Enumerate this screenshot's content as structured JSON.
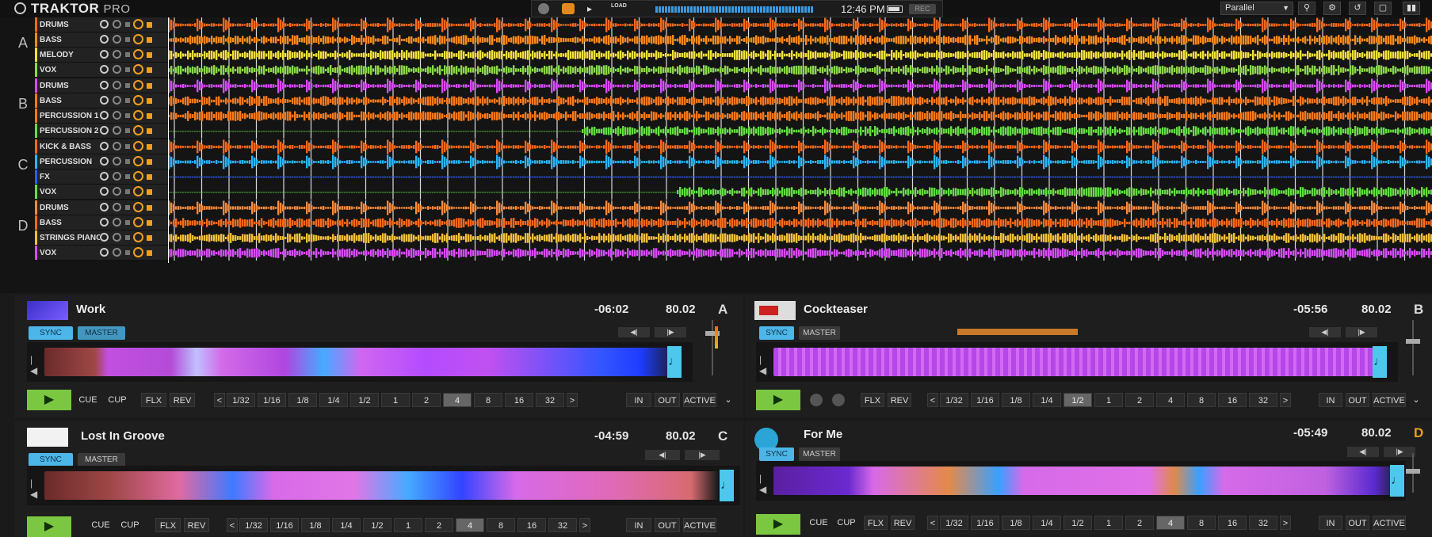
{
  "app": {
    "name": "TRAKTOR",
    "edition": "PRO"
  },
  "header": {
    "load_label": "LOAD",
    "clock": "12:46 PM",
    "rec_label": "REC",
    "mixer_mode": "Parallel",
    "icons": [
      "volume-icon",
      "load-icon",
      "battery-icon",
      "search-icon",
      "settings-icon",
      "loop-icon",
      "fullscreen-icon",
      "layout-icon"
    ]
  },
  "colors": {
    "sync": "#4db6e8",
    "play": "#7bc741",
    "stem_orange": "#ff6a1a",
    "stem_blue": "#2f5bff",
    "stem_magenta": "#d94cff",
    "stem_yellow": "#f4e03a",
    "stem_green": "#66dd44",
    "stem_cyan": "#2bb6ff"
  },
  "stem_decks": [
    {
      "letter": "A",
      "stems": [
        {
          "name": "DRUMS",
          "color": "#ff6a1a"
        },
        {
          "name": "BASS",
          "color": "#ff8a1a"
        },
        {
          "name": "MELODY",
          "color": "#f4e03a"
        },
        {
          "name": "VOX",
          "color": "#8cd84a"
        }
      ]
    },
    {
      "letter": "B",
      "stems": [
        {
          "name": "DRUMS",
          "color": "#d94cff"
        },
        {
          "name": "BASS",
          "color": "#ff7a1a"
        },
        {
          "name": "PERCUSSION 1",
          "color": "#ff7a1a"
        },
        {
          "name": "PERCUSSION 2",
          "color": "#66dd44"
        }
      ]
    },
    {
      "letter": "C",
      "stems": [
        {
          "name": "KICK & BASS",
          "color": "#ff6a1a"
        },
        {
          "name": "PERCUSSION",
          "color": "#2bb6ff"
        },
        {
          "name": "FX",
          "color": "#2f5bff"
        },
        {
          "name": "VOX",
          "color": "#66dd44"
        }
      ]
    },
    {
      "letter": "D",
      "stems": [
        {
          "name": "DRUMS",
          "color": "#ff8a3a"
        },
        {
          "name": "BASS",
          "color": "#ff6a1a"
        },
        {
          "name": "STRINGS PIANO",
          "color": "#f4c03a"
        },
        {
          "name": "VOX",
          "color": "#d94cff"
        }
      ]
    }
  ],
  "decks": {
    "a": {
      "letter": "A",
      "title": "Work",
      "remaining": "-06:02",
      "bpm": "80.02",
      "sync": "SYNC",
      "master": "MASTER"
    },
    "b": {
      "letter": "B",
      "title": "Cockteaser",
      "remaining": "-05:56",
      "bpm": "80.02",
      "sync": "SYNC",
      "master": "MASTER"
    },
    "c": {
      "letter": "C",
      "title": "Lost In Groove",
      "remaining": "-04:59",
      "bpm": "80.02",
      "sync": "SYNC",
      "master": "MASTER"
    },
    "d": {
      "letter": "D",
      "title": "For Me",
      "remaining": "-05:49",
      "bpm": "80.02",
      "sync": "SYNC",
      "master": "MASTER"
    }
  },
  "transport": {
    "cue": "CUE",
    "cup": "CUP",
    "flx": "FLX",
    "rev": "REV",
    "loop_sizes": [
      "1/32",
      "1/16",
      "1/8",
      "1/4",
      "1/2",
      "1",
      "2",
      "4",
      "8",
      "16",
      "32"
    ],
    "loop_prev": "<",
    "loop_next": ">",
    "in": "IN",
    "out": "OUT",
    "active": "ACTIVE"
  },
  "selected_loop": {
    "a": "4",
    "b": "1/2",
    "c": "4",
    "d": "4"
  }
}
